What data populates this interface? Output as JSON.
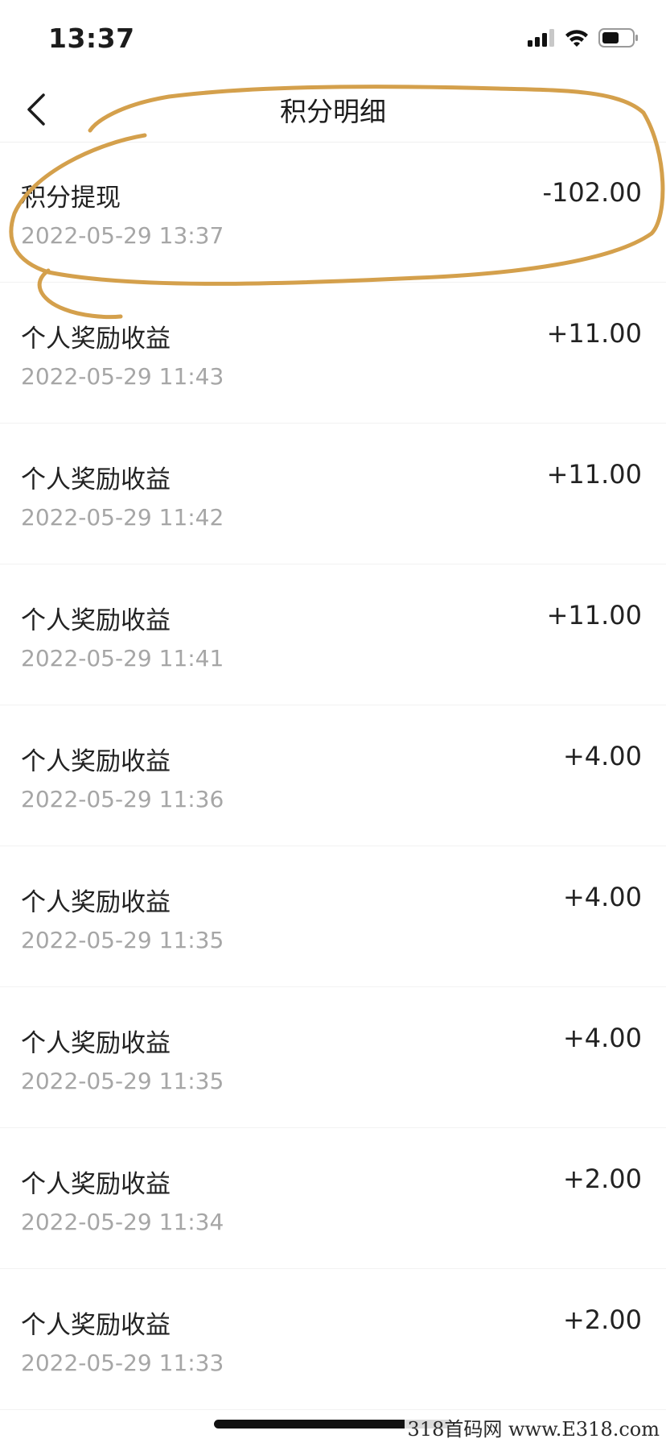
{
  "status_bar": {
    "time": "13:37",
    "icons": [
      "cellular-signal-icon",
      "wifi-icon",
      "battery-icon"
    ]
  },
  "nav": {
    "title": "积分明细",
    "back_icon": "chevron-left-icon"
  },
  "records": [
    {
      "title": "积分提现",
      "time": "2022-05-29 13:37",
      "amount": "-102.00"
    },
    {
      "title": "个人奖励收益",
      "time": "2022-05-29 11:43",
      "amount": "+11.00"
    },
    {
      "title": "个人奖励收益",
      "time": "2022-05-29 11:42",
      "amount": "+11.00"
    },
    {
      "title": "个人奖励收益",
      "time": "2022-05-29 11:41",
      "amount": "+11.00"
    },
    {
      "title": "个人奖励收益",
      "time": "2022-05-29 11:36",
      "amount": "+4.00"
    },
    {
      "title": "个人奖励收益",
      "time": "2022-05-29 11:35",
      "amount": "+4.00"
    },
    {
      "title": "个人奖励收益",
      "time": "2022-05-29 11:35",
      "amount": "+4.00"
    },
    {
      "title": "个人奖励收益",
      "time": "2022-05-29 11:34",
      "amount": "+2.00"
    },
    {
      "title": "个人奖励收益",
      "time": "2022-05-29 11:33",
      "amount": "+2.00"
    }
  ],
  "annotation": {
    "color": "#D4A04C"
  },
  "watermark": {
    "text": "318首码网 www.E318.com"
  }
}
